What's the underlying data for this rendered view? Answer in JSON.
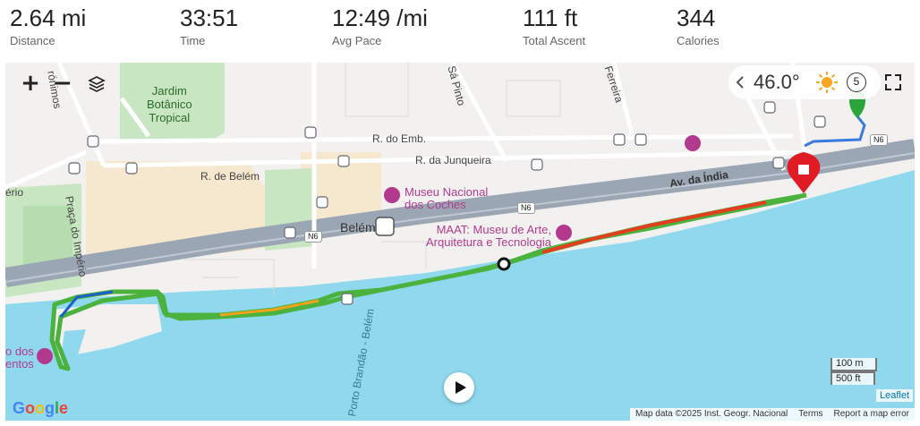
{
  "stats": [
    {
      "value": "2.64 mi",
      "label": "Distance"
    },
    {
      "value": "33:51",
      "label": "Time"
    },
    {
      "value": "12:49 /mi",
      "label": "Avg Pace"
    },
    {
      "value": "111 ft",
      "label": "Total Ascent"
    },
    {
      "value": "344",
      "label": "Calories"
    }
  ],
  "map": {
    "controls": {
      "zoom_in": "+",
      "zoom_out": "−"
    },
    "weather": {
      "temp": "46.0°",
      "wind": "5"
    },
    "labels": {
      "garden": "Jardim\nBotânico\nTropical",
      "r_emb": "R. do Emb.",
      "r_junqueira": "R. da Junqueira",
      "r_belem": "R. de Belém",
      "av_india": "Av. da Índia",
      "sa_pinto": "Sá Pinto",
      "ferreira": "Ferreira",
      "jeronimos": "rónimos",
      "praca_imperio": "Praça do Império",
      "erio": "ério",
      "belem_station": "Belém",
      "porto_brandao": "Porto Brandão - Belém",
      "museu_coches": "Museu Nacional\ndos Coches",
      "maat": "MAAT: Museu de Arte,\nArquitetura e Tecnologia",
      "descobrimentos": "o dos\nentos",
      "n6_a": "N6",
      "n6_b": "N6",
      "n6_c": "N6"
    },
    "scale": {
      "metric": "100 m",
      "imperial": "500 ft"
    },
    "leaflet": "Leaflet",
    "google": "Google",
    "attribution": [
      "Map data ©2025 Inst. Geogr. Nacional",
      "Terms",
      "Report a map error"
    ],
    "colors": {
      "water": "#8fd8ed",
      "road": "#9aa6b4",
      "park": "#c8e6c1",
      "sand": "#f5e8cf",
      "start": "#2ca43c",
      "finish": "#e01b24",
      "poi": "#b3398f"
    }
  }
}
